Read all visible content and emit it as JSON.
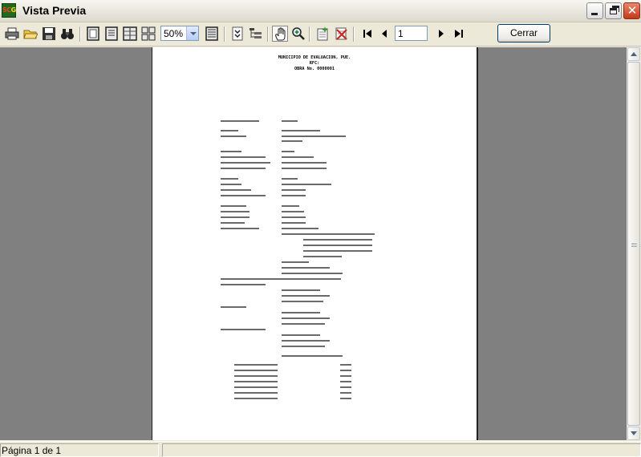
{
  "window": {
    "icon_text_a": "SC",
    "icon_text_b": "G",
    "title": "Vista Previa"
  },
  "toolbar": {
    "zoom_value": "50%",
    "page_number": "1",
    "close_label": "Cerrar",
    "icons": [
      "printer-icon",
      "open-folder-icon",
      "save-disk-icon",
      "binoculars-icon",
      "one-page-icon",
      "page-width-icon",
      "two-pages-icon",
      "four-pages-icon",
      "list-icon",
      "export-icon",
      "tree-icon",
      "hand-icon",
      "zoom-in-icon",
      "new-doc-icon",
      "delete-doc-icon",
      "first-page-icon",
      "previous-page-icon",
      "next-page-icon",
      "last-page-icon"
    ]
  },
  "document": {
    "header_line1": "MUNICIPIO DE EVALUACION, PUE.",
    "header_line2": "RFC:",
    "header_line3": "OBRA No. 0000001"
  },
  "status": {
    "page_info": "Página 1 de 1"
  }
}
